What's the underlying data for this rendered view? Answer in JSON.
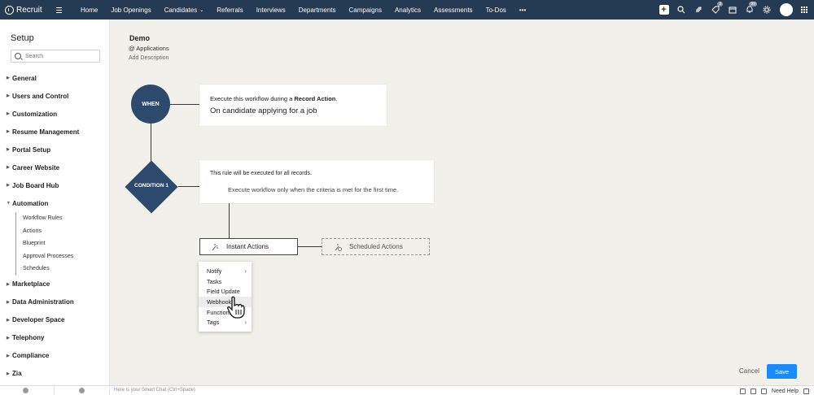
{
  "app": {
    "name": "Recruit"
  },
  "nav": {
    "items": [
      {
        "label": "Home"
      },
      {
        "label": "Job Openings"
      },
      {
        "label": "Candidates",
        "chevron": "⌄"
      },
      {
        "label": "Referrals"
      },
      {
        "label": "Interviews"
      },
      {
        "label": "Departments"
      },
      {
        "label": "Campaigns"
      },
      {
        "label": "Analytics"
      },
      {
        "label": "Assessments"
      },
      {
        "label": "To-Dos"
      }
    ],
    "more": "•••",
    "badges": {
      "tasks": "3",
      "notifications": "99"
    }
  },
  "sidebar": {
    "title": "Setup",
    "search_placeholder": "Search",
    "items": [
      {
        "label": "General"
      },
      {
        "label": "Users and Control"
      },
      {
        "label": "Customization"
      },
      {
        "label": "Resume Management"
      },
      {
        "label": "Portal Setup"
      },
      {
        "label": "Career Website"
      },
      {
        "label": "Job Board Hub"
      },
      {
        "label": "Automation"
      },
      {
        "label": "Marketplace"
      },
      {
        "label": "Data Administration"
      },
      {
        "label": "Developer Space"
      },
      {
        "label": "Telephony"
      },
      {
        "label": "Compliance"
      },
      {
        "label": "Zia"
      }
    ],
    "automation_sub": [
      {
        "label": "Workflow Rules"
      },
      {
        "label": "Actions"
      },
      {
        "label": "Blueprint"
      },
      {
        "label": "Approval Processes"
      },
      {
        "label": "Schedules"
      }
    ]
  },
  "workflow": {
    "name": "Demo",
    "module": "@ Applications",
    "add_description": "Add Description",
    "when_label": "WHEN",
    "when_line1_prefix": "Execute this workflow during a ",
    "when_line1_bold": "Record Action",
    "when_line1_suffix": ".",
    "when_line2": "On candidate applying for a job",
    "condition_label": "CONDITION 1",
    "condition_line1": "This rule will be executed for all records.",
    "condition_line2": "Execute workflow only when the criteria is met for the first time.",
    "instant_actions": "Instant Actions",
    "scheduled_actions": "Scheduled Actions"
  },
  "dropdown": {
    "items": [
      {
        "label": "Notify",
        "has_submenu": true
      },
      {
        "label": "Tasks"
      },
      {
        "label": "Field Update"
      },
      {
        "label": "Webhooks"
      },
      {
        "label": "Functions"
      },
      {
        "label": "Tags",
        "has_submenu": true
      }
    ],
    "arrow": "›"
  },
  "buttons": {
    "cancel": "Cancel",
    "save": "Save"
  },
  "bottom": {
    "chat_placeholder": "Here is your Smart Chat (Ctrl+Space)",
    "need_help": "Need Help"
  },
  "colors": {
    "topbar": "#243b53",
    "node": "#2d4a6c",
    "save": "#1a8cff",
    "canvas": "#f1f0ea"
  }
}
